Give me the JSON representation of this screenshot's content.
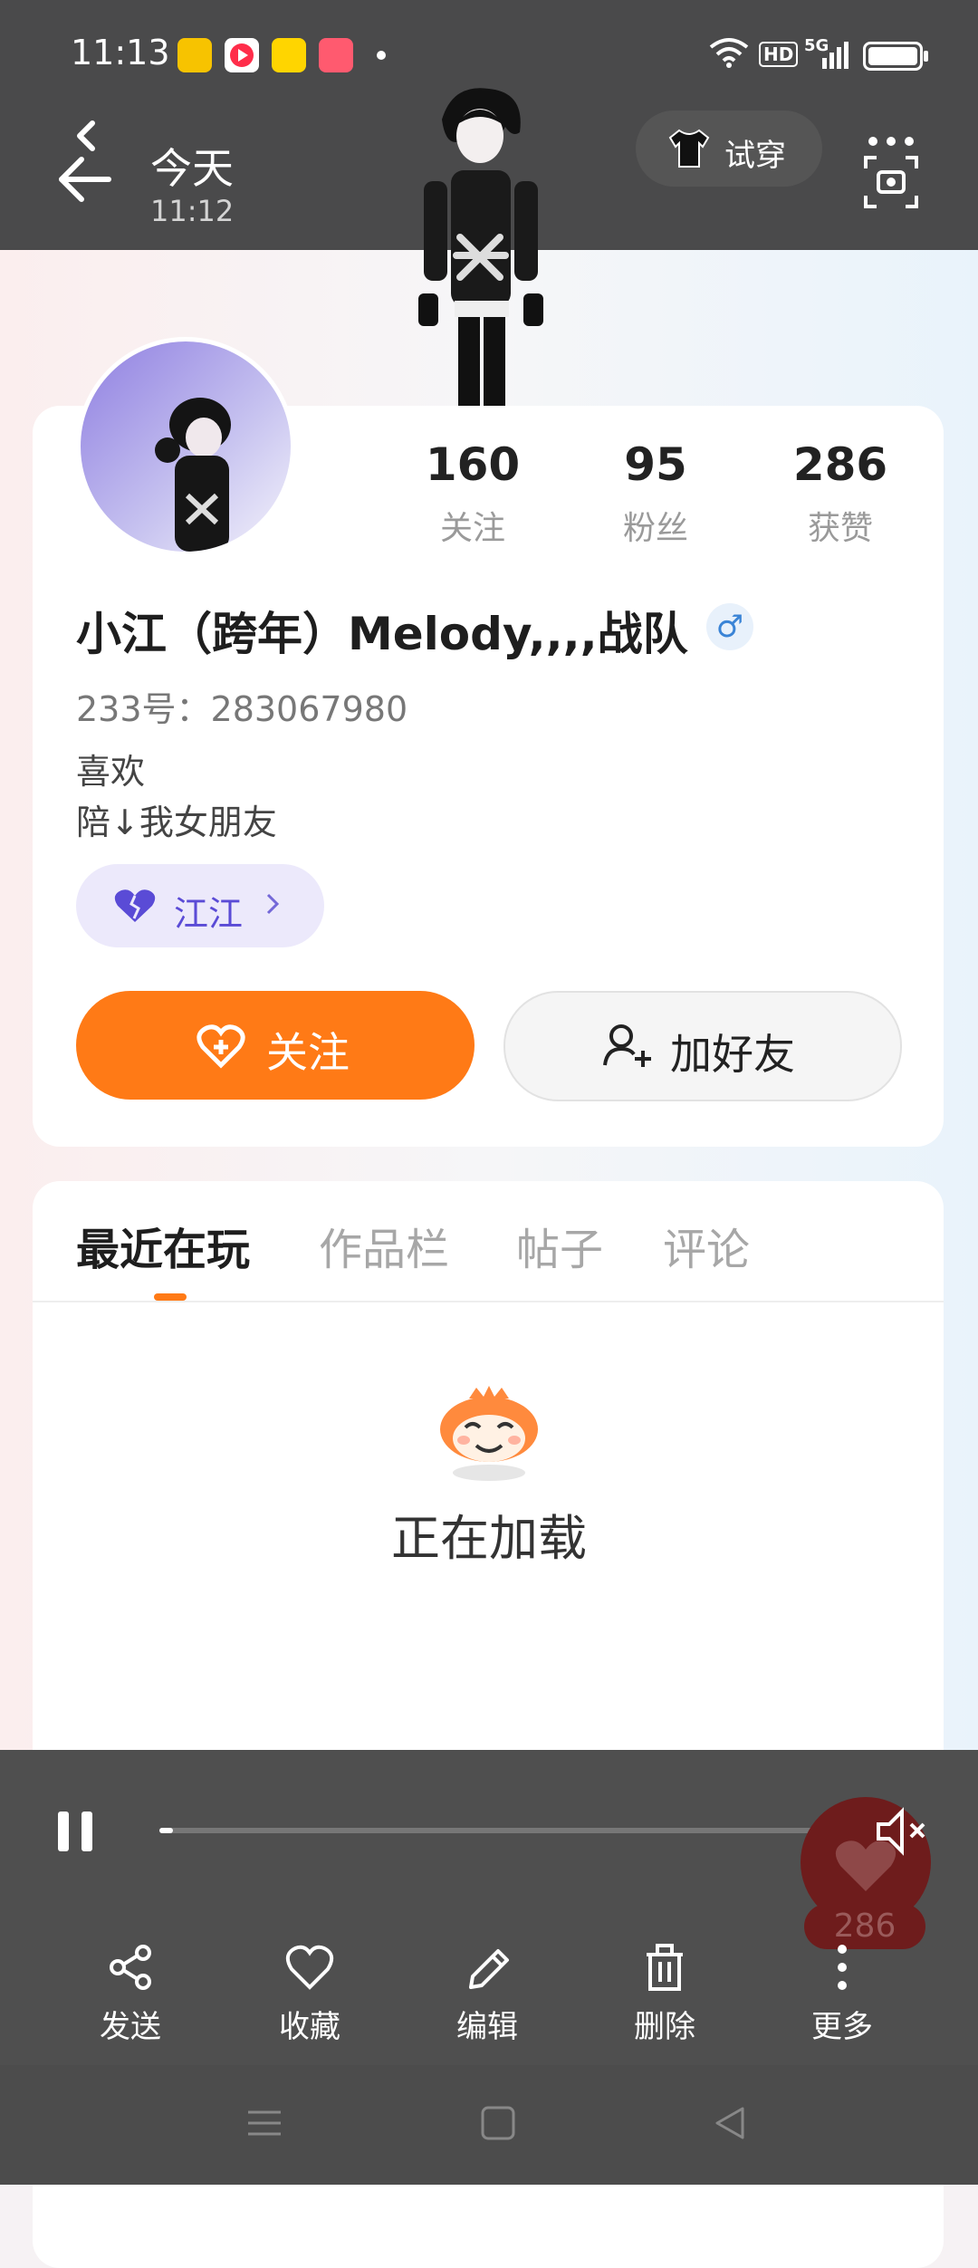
{
  "status_bar": {
    "time": "11:13",
    "network": "5G",
    "hd": "HD",
    "app_icons": [
      {
        "name": "meituan-icon",
        "color": "#f7c300"
      },
      {
        "name": "video-icon",
        "color": "#ff2d4a"
      },
      {
        "name": "bunny-icon",
        "color": "#ffd500"
      },
      {
        "name": "app-icon",
        "color": "#ff5a6f"
      }
    ]
  },
  "nav": {
    "title": "今天",
    "subtitle": "11:12",
    "tryon_label": "试穿"
  },
  "profile": {
    "stats": [
      {
        "value": "160",
        "label": "关注"
      },
      {
        "value": "95",
        "label": "粉丝"
      },
      {
        "value": "286",
        "label": "获赞"
      }
    ],
    "name": "小江（跨年）Melody,,,,战队",
    "gender_symbol": "♂",
    "uid": "233号：283067980",
    "bio_line1": "喜欢",
    "bio_line2": "陪↓我女朋友",
    "tag_label": "江江",
    "follow_label": "关注",
    "add_friend_label": "加好友"
  },
  "tabs": [
    {
      "label": "最近在玩",
      "active": true
    },
    {
      "label": "作品栏",
      "active": false
    },
    {
      "label": "帖子",
      "active": false
    },
    {
      "label": "评论",
      "active": false
    }
  ],
  "loading_text": "正在加载",
  "player": {
    "progress": 0.02,
    "like_count": "286",
    "actions": [
      {
        "label": "发送",
        "icon": "share-icon"
      },
      {
        "label": "收藏",
        "icon": "heart-icon"
      },
      {
        "label": "编辑",
        "icon": "pencil-icon"
      },
      {
        "label": "删除",
        "icon": "trash-icon"
      },
      {
        "label": "更多",
        "icon": "more-icon"
      }
    ]
  },
  "colors": {
    "accent": "#ff7a16",
    "tag_bg": "#ece9fb",
    "tag_text": "#5a4bd6",
    "dark_bar": "#4a4a4b"
  }
}
